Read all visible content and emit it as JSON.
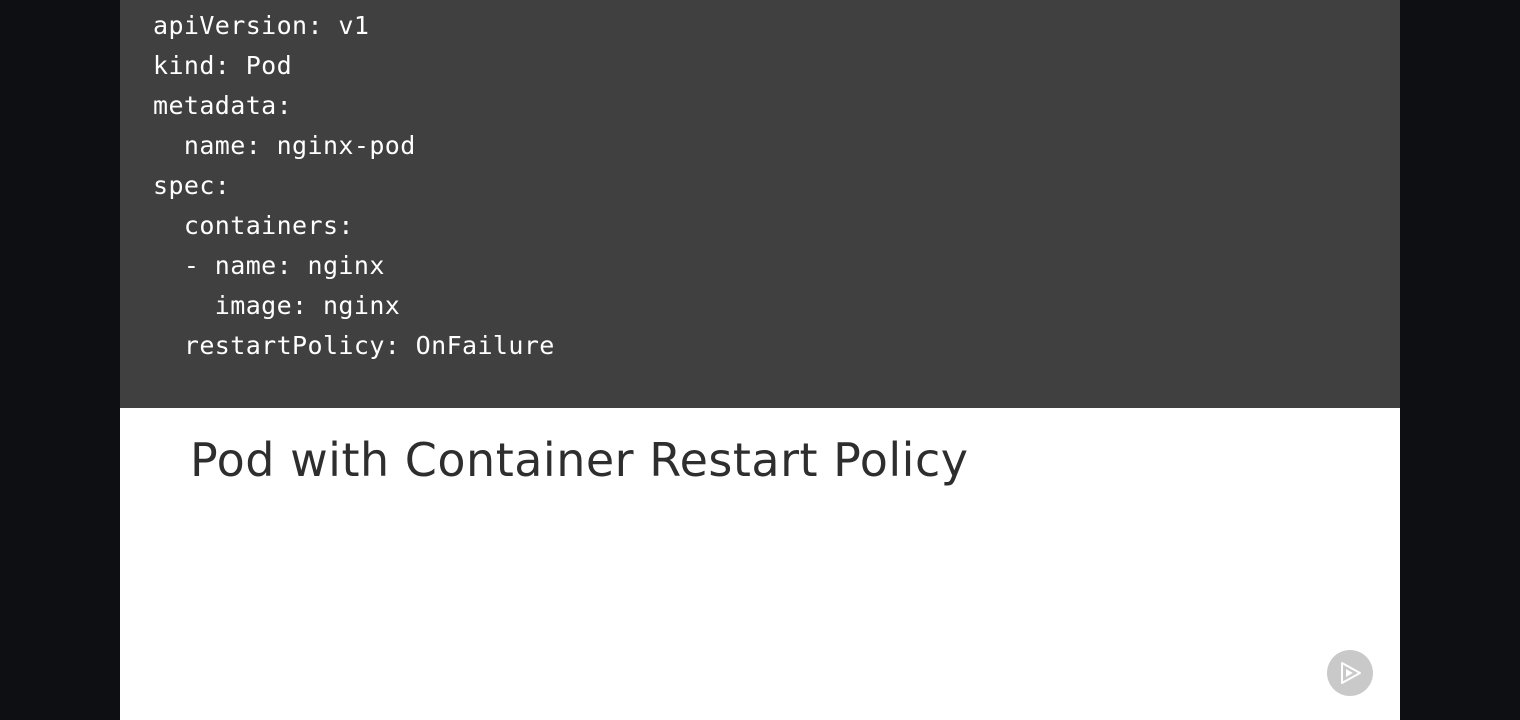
{
  "slide": {
    "code_lines": [
      "apiVersion: v1",
      "kind: Pod",
      "metadata:",
      "  name: nginx-pod",
      "spec:",
      "  containers:",
      "  - name: nginx",
      "    image: nginx",
      "  restartPolicy: OnFailure"
    ],
    "title": "Pod with Container Restart Policy",
    "logo_icon": "play-logo-icon"
  },
  "colors": {
    "frame_background": "#0d0f13",
    "slide_background": "#ffffff",
    "code_background": "#404040",
    "code_text": "#ffffff",
    "title_text": "#2e2e2e",
    "logo": "#c9c9c9"
  }
}
